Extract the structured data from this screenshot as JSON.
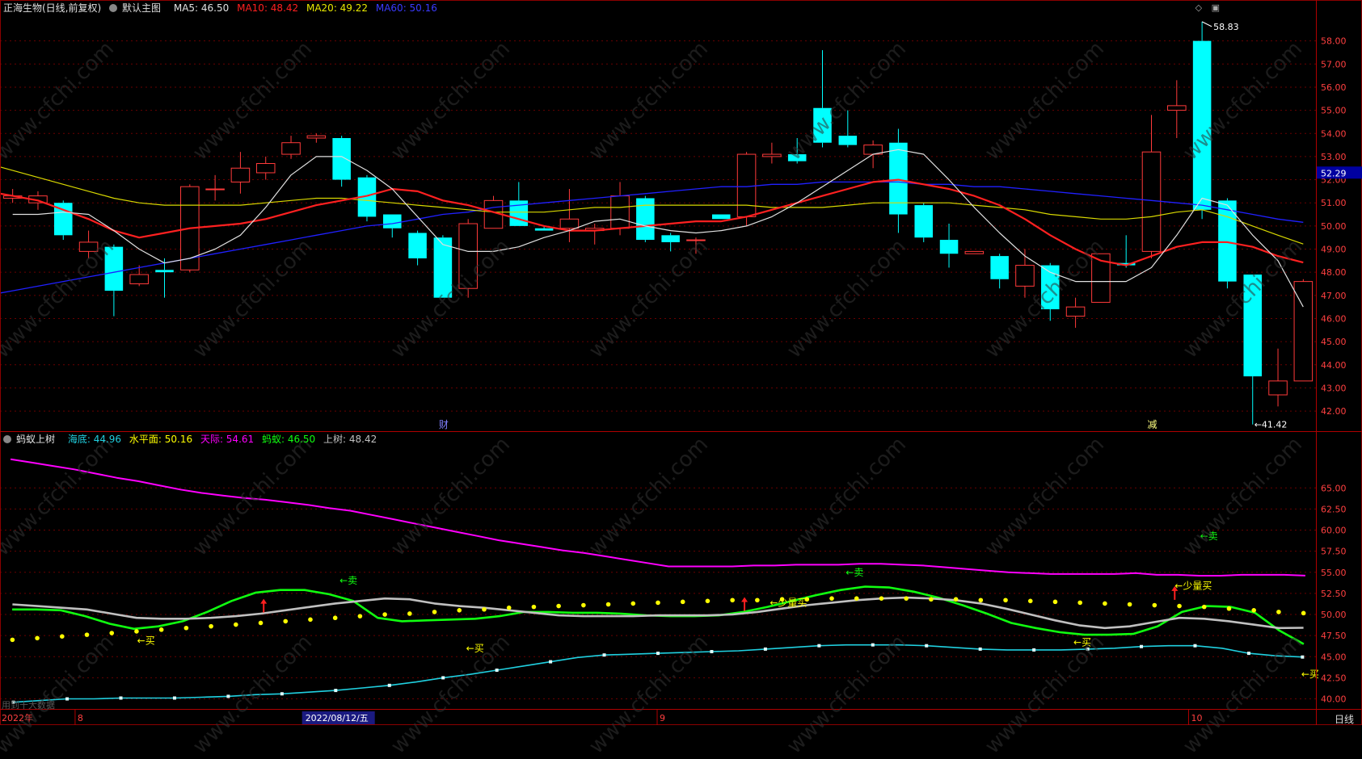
{
  "main_header": {
    "title": "正海生物(日线,前复权)",
    "template": "默认主图",
    "ma5": "MA5: 46.50",
    "ma10": "MA10: 48.42",
    "ma20": "MA20: 49.22",
    "ma60": "MA60: 50.16"
  },
  "sub_header": {
    "name": "蚂蚁上树",
    "haidi": "海底: 44.96",
    "shuiping": "水平面: 50.16",
    "tianji": "天际: 54.61",
    "mayi": "蚂蚁: 46.50",
    "shangshu": "上树: 48.42"
  },
  "top_icons": [
    "◇",
    "▣"
  ],
  "colors": {
    "up": "#ff3a3a",
    "down": "#00ffff",
    "ma5": "#e0e0e0",
    "ma10": "#ff2020",
    "ma20": "#d8d800",
    "ma60": "#2020ff",
    "tianji": "#ff00ff",
    "mayi": "#10ff10",
    "shangshu": "#c0c0c0",
    "haidi": "#20d0e0",
    "dots": "#ffff00"
  },
  "chart_data": [
    {
      "type": "candlestick",
      "title": "正海生物(日线,前复权)",
      "ylim": [
        41.2,
        59.0
      ],
      "y_ticks": [
        "58.00",
        "57.00",
        "56.00",
        "55.00",
        "54.00",
        "53.00",
        "52.00",
        "51.00",
        "50.00",
        "49.00",
        "48.00",
        "47.00",
        "46.00",
        "45.00",
        "44.00",
        "43.00",
        "42.00"
      ],
      "last_price_label": "52.29",
      "max_label": "58.83",
      "min_label": "41.42",
      "event_markers": [
        "财",
        "减"
      ],
      "candles": [
        {
          "o": 51.2,
          "h": 51.6,
          "l": 51.0,
          "c": 51.3
        },
        {
          "o": 51.0,
          "h": 51.5,
          "l": 50.7,
          "c": 51.3
        },
        {
          "o": 51.0,
          "h": 51.1,
          "l": 49.4,
          "c": 49.6
        },
        {
          "o": 48.9,
          "h": 49.8,
          "l": 48.6,
          "c": 49.3
        },
        {
          "o": 49.1,
          "h": 49.2,
          "l": 46.1,
          "c": 47.2
        },
        {
          "o": 47.5,
          "h": 48.3,
          "l": 47.4,
          "c": 47.9
        },
        {
          "o": 48.1,
          "h": 48.6,
          "l": 46.9,
          "c": 48.0
        },
        {
          "o": 48.1,
          "h": 51.8,
          "l": 48.0,
          "c": 51.7
        },
        {
          "o": 51.6,
          "h": 52.2,
          "l": 51.1,
          "c": 51.6
        },
        {
          "o": 51.9,
          "h": 53.2,
          "l": 51.4,
          "c": 52.5
        },
        {
          "o": 52.3,
          "h": 53.0,
          "l": 52.0,
          "c": 52.7
        },
        {
          "o": 53.1,
          "h": 53.9,
          "l": 52.9,
          "c": 53.6
        },
        {
          "o": 53.8,
          "h": 54.0,
          "l": 53.6,
          "c": 53.9
        },
        {
          "o": 53.8,
          "h": 53.9,
          "l": 51.7,
          "c": 52.0
        },
        {
          "o": 52.1,
          "h": 52.2,
          "l": 50.2,
          "c": 50.4
        },
        {
          "o": 50.5,
          "h": 50.5,
          "l": 49.5,
          "c": 49.9
        },
        {
          "o": 49.7,
          "h": 49.8,
          "l": 48.3,
          "c": 48.6
        },
        {
          "o": 49.5,
          "h": 49.6,
          "l": 46.9,
          "c": 46.9
        },
        {
          "o": 47.3,
          "h": 50.3,
          "l": 46.9,
          "c": 50.1
        },
        {
          "o": 49.9,
          "h": 51.3,
          "l": 49.9,
          "c": 51.1
        },
        {
          "o": 51.1,
          "h": 51.9,
          "l": 50.0,
          "c": 50.0
        },
        {
          "o": 49.9,
          "h": 50.0,
          "l": 49.8,
          "c": 49.8
        },
        {
          "o": 49.9,
          "h": 51.6,
          "l": 49.3,
          "c": 50.3
        },
        {
          "o": 49.8,
          "h": 50.1,
          "l": 49.2,
          "c": 49.9
        },
        {
          "o": 49.9,
          "h": 51.9,
          "l": 49.6,
          "c": 51.3
        },
        {
          "o": 51.2,
          "h": 51.3,
          "l": 49.3,
          "c": 49.4
        },
        {
          "o": 49.6,
          "h": 49.7,
          "l": 48.9,
          "c": 49.3
        },
        {
          "o": 49.4,
          "h": 49.5,
          "l": 48.8,
          "c": 49.4
        },
        {
          "o": 50.5,
          "h": 50.5,
          "l": 50.3,
          "c": 50.3
        },
        {
          "o": 50.4,
          "h": 53.2,
          "l": 50.0,
          "c": 53.1
        },
        {
          "o": 53.0,
          "h": 53.6,
          "l": 52.7,
          "c": 53.1
        },
        {
          "o": 53.1,
          "h": 53.8,
          "l": 52.7,
          "c": 52.8
        },
        {
          "o": 55.1,
          "h": 57.6,
          "l": 53.4,
          "c": 53.6
        },
        {
          "o": 53.9,
          "h": 55.0,
          "l": 53.4,
          "c": 53.5
        },
        {
          "o": 53.1,
          "h": 53.7,
          "l": 52.5,
          "c": 53.5
        },
        {
          "o": 53.6,
          "h": 54.2,
          "l": 49.7,
          "c": 50.5
        },
        {
          "o": 50.9,
          "h": 51.0,
          "l": 49.3,
          "c": 49.5
        },
        {
          "o": 49.4,
          "h": 50.1,
          "l": 48.2,
          "c": 48.8
        },
        {
          "o": 48.8,
          "h": 48.9,
          "l": 48.8,
          "c": 48.9
        },
        {
          "o": 48.7,
          "h": 48.8,
          "l": 47.3,
          "c": 47.7
        },
        {
          "o": 47.4,
          "h": 49.0,
          "l": 46.9,
          "c": 48.3
        },
        {
          "o": 48.3,
          "h": 48.4,
          "l": 45.9,
          "c": 46.4
        },
        {
          "o": 46.1,
          "h": 46.9,
          "l": 45.6,
          "c": 46.5
        },
        {
          "o": 46.7,
          "h": 48.8,
          "l": 46.7,
          "c": 48.8
        },
        {
          "o": 48.4,
          "h": 49.6,
          "l": 48.2,
          "c": 48.3
        },
        {
          "o": 48.9,
          "h": 54.8,
          "l": 48.6,
          "c": 53.2
        },
        {
          "o": 55.0,
          "h": 56.3,
          "l": 53.8,
          "c": 55.2
        },
        {
          "o": 58.0,
          "h": 58.83,
          "l": 50.3,
          "c": 50.7
        },
        {
          "o": 51.1,
          "h": 51.2,
          "l": 47.3,
          "c": 47.6
        },
        {
          "o": 47.9,
          "h": 47.9,
          "l": 41.42,
          "c": 43.5
        },
        {
          "o": 42.7,
          "h": 44.7,
          "l": 42.2,
          "c": 43.3
        },
        {
          "o": 43.3,
          "h": 47.7,
          "l": 43.3,
          "c": 47.6
        }
      ],
      "ma5": [
        50.5,
        50.5,
        50.6,
        50.5,
        49.8,
        49.0,
        48.4,
        48.6,
        49.0,
        49.6,
        50.8,
        52.2,
        53.0,
        53.0,
        52.4,
        51.6,
        50.4,
        49.2,
        48.9,
        48.9,
        49.1,
        49.5,
        49.8,
        50.2,
        50.3,
        50.0,
        49.8,
        49.7,
        49.8,
        50.0,
        50.4,
        51.0,
        51.7,
        52.4,
        53.1,
        53.3,
        53.1,
        52.0,
        50.8,
        49.7,
        48.7,
        48.0,
        47.6,
        47.6,
        47.6,
        48.2,
        49.6,
        51.2,
        50.9,
        49.6,
        48.5,
        46.5
      ],
      "ma10": [
        51.5,
        51.3,
        51.1,
        50.7,
        50.3,
        49.8,
        49.5,
        49.7,
        49.9,
        50.0,
        50.1,
        50.3,
        50.6,
        50.9,
        51.1,
        51.3,
        51.6,
        51.5,
        51.1,
        50.9,
        50.6,
        50.3,
        50.0,
        49.8,
        49.8,
        49.9,
        50.0,
        50.1,
        50.2,
        50.2,
        50.4,
        50.7,
        51.0,
        51.3,
        51.6,
        51.9,
        52.0,
        51.8,
        51.6,
        51.3,
        50.9,
        50.3,
        49.6,
        49.0,
        48.5,
        48.3,
        48.7,
        49.1,
        49.3,
        49.3,
        49.1,
        48.7,
        48.42
      ],
      "ma20": [
        52.7,
        52.4,
        52.1,
        51.8,
        51.5,
        51.2,
        51.0,
        50.9,
        50.9,
        50.9,
        50.9,
        51.0,
        51.1,
        51.2,
        51.2,
        51.1,
        51.0,
        50.9,
        50.8,
        50.7,
        50.6,
        50.6,
        50.6,
        50.7,
        50.8,
        50.8,
        50.9,
        50.9,
        50.9,
        50.9,
        50.9,
        50.8,
        50.8,
        50.8,
        50.9,
        51.0,
        51.0,
        51.0,
        51.0,
        50.9,
        50.8,
        50.7,
        50.5,
        50.4,
        50.3,
        50.3,
        50.4,
        50.6,
        50.7,
        50.4,
        50.0,
        49.6,
        49.22
      ],
      "ma60": [
        47.0,
        47.2,
        47.4,
        47.6,
        47.8,
        48.0,
        48.2,
        48.4,
        48.6,
        48.8,
        49.0,
        49.2,
        49.4,
        49.6,
        49.8,
        50.0,
        50.1,
        50.3,
        50.5,
        50.6,
        50.8,
        50.9,
        51.0,
        51.1,
        51.2,
        51.3,
        51.4,
        51.5,
        51.6,
        51.7,
        51.7,
        51.8,
        51.8,
        51.9,
        51.9,
        51.9,
        51.9,
        51.8,
        51.8,
        51.7,
        51.7,
        51.6,
        51.5,
        51.4,
        51.3,
        51.2,
        51.1,
        51.0,
        50.9,
        50.7,
        50.5,
        50.3,
        50.16
      ]
    },
    {
      "type": "line",
      "title": "蚂蚁上树",
      "ylim": [
        39.0,
        70.0
      ],
      "y_ticks": [
        "65.00",
        "62.50",
        "60.00",
        "57.50",
        "55.00",
        "52.50",
        "50.00",
        "47.50",
        "45.00",
        "42.50",
        "40.00"
      ],
      "series": [
        {
          "name": "天际",
          "values": [
            68.4,
            68.0,
            67.6,
            67.2,
            66.7,
            66.2,
            65.8,
            65.3,
            64.8,
            64.4,
            64.1,
            63.8,
            63.6,
            63.3,
            63.0,
            62.6,
            62.3,
            61.8,
            61.3,
            60.8,
            60.3,
            59.8,
            59.3,
            58.8,
            58.4,
            58.0,
            57.6,
            57.3,
            56.9,
            56.5,
            56.1,
            55.7,
            55.7,
            55.7,
            55.7,
            55.8,
            55.8,
            55.9,
            55.9,
            55.9,
            56.0,
            56.0,
            55.9,
            55.8,
            55.6,
            55.4,
            55.2,
            55.0,
            54.9,
            54.8,
            54.8,
            54.8,
            54.8,
            54.9,
            54.7,
            54.7,
            54.6,
            54.6,
            54.7,
            54.7,
            54.7,
            54.61
          ]
        },
        {
          "name": "蚂蚁",
          "values": [
            50.6,
            50.6,
            50.5,
            49.8,
            48.9,
            48.3,
            48.6,
            49.2,
            50.3,
            51.6,
            52.6,
            52.9,
            52.9,
            52.4,
            51.6,
            49.6,
            49.2,
            49.3,
            49.4,
            49.5,
            49.8,
            50.3,
            50.3,
            50.2,
            50.2,
            50.1,
            49.9,
            49.8,
            49.8,
            49.9,
            50.3,
            50.9,
            51.6,
            52.3,
            52.9,
            53.3,
            53.2,
            52.7,
            52.0,
            51.1,
            50.1,
            49.0,
            48.4,
            47.9,
            47.6,
            47.6,
            47.7,
            48.6,
            50.3,
            51.0,
            50.9,
            50.2,
            48.1,
            46.5
          ]
        },
        {
          "name": "上树",
          "values": [
            51.2,
            51.0,
            50.8,
            50.6,
            50.1,
            49.6,
            49.5,
            49.5,
            49.6,
            49.8,
            50.1,
            50.5,
            50.9,
            51.3,
            51.6,
            51.9,
            51.8,
            51.3,
            51.0,
            50.8,
            50.5,
            50.2,
            49.9,
            49.8,
            49.8,
            49.8,
            49.9,
            49.9,
            49.9,
            50.0,
            50.3,
            50.7,
            51.1,
            51.4,
            51.7,
            51.9,
            52.0,
            51.9,
            51.7,
            51.3,
            50.7,
            50.0,
            49.3,
            48.7,
            48.4,
            48.6,
            49.1,
            49.6,
            49.5,
            49.2,
            48.8,
            48.4,
            48.42
          ]
        },
        {
          "name": "海底",
          "values": [
            39.6,
            39.8,
            40.0,
            40.0,
            40.1,
            40.1,
            40.1,
            40.2,
            40.3,
            40.5,
            40.6,
            40.8,
            41.0,
            41.3,
            41.6,
            42.0,
            42.5,
            42.9,
            43.4,
            43.9,
            44.4,
            44.9,
            45.2,
            45.3,
            45.4,
            45.5,
            45.6,
            45.7,
            45.9,
            46.1,
            46.3,
            46.4,
            46.4,
            46.4,
            46.3,
            46.1,
            45.9,
            45.8,
            45.8,
            45.8,
            45.9,
            46.0,
            46.2,
            46.3,
            46.3,
            46.0,
            45.4,
            45.1,
            44.96
          ]
        },
        {
          "name": "水平面",
          "values": [
            47.0,
            47.2,
            47.4,
            47.6,
            47.8,
            48.0,
            48.2,
            48.4,
            48.6,
            48.8,
            49.0,
            49.2,
            49.4,
            49.6,
            49.8,
            50.0,
            50.1,
            50.3,
            50.5,
            50.6,
            50.8,
            50.9,
            51.0,
            51.1,
            51.2,
            51.3,
            51.4,
            51.5,
            51.6,
            51.7,
            51.7,
            51.8,
            51.8,
            51.9,
            51.9,
            51.9,
            51.9,
            51.8,
            51.8,
            51.7,
            51.7,
            51.6,
            51.5,
            51.4,
            51.3,
            51.2,
            51.1,
            51.0,
            50.9,
            50.7,
            50.5,
            50.3,
            50.16
          ]
        }
      ],
      "signals": [
        {
          "text": "←买",
          "color": "#ffff00",
          "i": 5,
          "y": 46.9
        },
        {
          "text": "←卖",
          "color": "#10ff10",
          "i": 13,
          "y": 54.0
        },
        {
          "text": "←买",
          "color": "#ffff00",
          "i": 18,
          "y": 46.0
        },
        {
          "text": "←少量买",
          "color": "#ffff00",
          "i": 30,
          "y": 51.4
        },
        {
          "text": "←卖",
          "color": "#10ff10",
          "i": 33,
          "y": 55.0
        },
        {
          "text": "←买",
          "color": "#ffff00",
          "i": 42,
          "y": 46.7
        },
        {
          "text": "←卖",
          "color": "#10ff10",
          "i": 47,
          "y": 59.3
        },
        {
          "text": "←少量买",
          "color": "#ffff00",
          "i": 46,
          "y": 53.4
        },
        {
          "text": "←买",
          "color": "#ffff00",
          "i": 51,
          "y": 42.9
        }
      ],
      "arrows": [
        {
          "i": 10,
          "y": 51.0
        },
        {
          "i": 29,
          "y": 51.2
        },
        {
          "i": 46,
          "y": 52.5
        }
      ]
    }
  ],
  "x_axis": {
    "labels": [
      {
        "text": "2022年",
        "i": 0,
        "color": "#ff4040"
      },
      {
        "text": "8",
        "i": 3,
        "color": "#ff4040"
      },
      {
        "text": "2022/08/12/五",
        "i": 12,
        "color": "#ffffff",
        "highlight": true
      },
      {
        "text": "9",
        "i": 26,
        "color": "#ff4040"
      },
      {
        "text": "10",
        "i": 47,
        "color": "#ff4040"
      }
    ],
    "period": "日线",
    "copyright": "用到十大数据"
  },
  "watermark": "www.cfchi.com"
}
